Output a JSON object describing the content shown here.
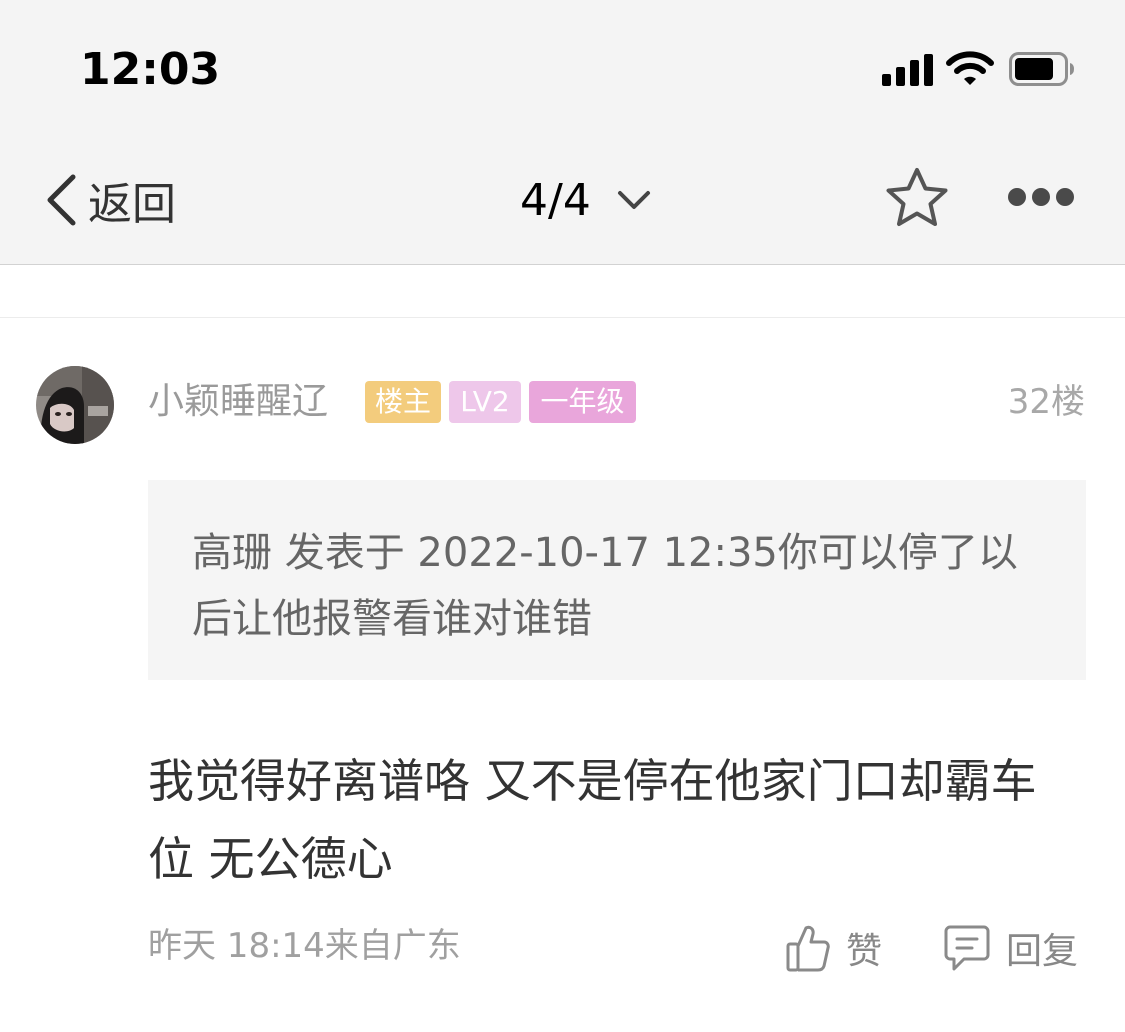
{
  "status_bar": {
    "time": "12:03",
    "icons": [
      "cellular-signal-icon",
      "wifi-icon",
      "battery-icon"
    ]
  },
  "nav": {
    "back_label": "返回",
    "page_indicator": "4/4",
    "icons": [
      "chevron-left-icon",
      "chevron-down-icon",
      "star-icon",
      "more-icon"
    ]
  },
  "post": {
    "username": "小颖睡醒辽",
    "badges": {
      "owner": "楼主",
      "level": "LV2",
      "grade": "一年级"
    },
    "badge_colors": {
      "owner": "#f3cc7d",
      "level": "#eec7ea",
      "grade": "#e9a6db"
    },
    "floor": "32楼",
    "quote": "高珊 发表于 2022-10-17 12:35你可以停了以后让他报警看谁对谁错",
    "body": "我觉得好离谱咯 又不是停在他家门口却霸车位 无公德心",
    "meta": "昨天 18:14来自广东",
    "actions": {
      "like": "赞",
      "reply": "回复"
    }
  },
  "colors": {
    "header_bg": "#f4f4f4",
    "text_primary": "#333333",
    "text_secondary": "#a0a0a0",
    "quote_bg": "#f5f5f5"
  }
}
